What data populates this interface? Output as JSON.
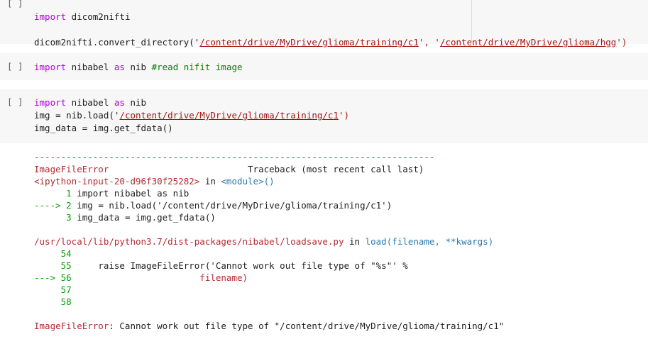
{
  "cells": [
    {
      "run_label": "[ ]",
      "lines": [
        {
          "kw": "import",
          "rest": " dicom2nifti"
        },
        {
          "blank": true
        },
        {
          "pre": "dicom2nifti.convert_directory('",
          "s1": "/content/drive/MyDrive/glioma/training/c1",
          "mid": "', '",
          "s2": "/content/drive/MyDrive/glioma/hgg",
          "post": "')"
        }
      ]
    },
    {
      "run_label": "[ ]",
      "kw": "import",
      "mod": " nibabel ",
      "kw2": "as",
      "alias": " nib ",
      "comment": "#read nifit image"
    },
    {
      "run_label": "[ ]",
      "line1_kw": "import",
      "line1_mod": " nibabel ",
      "line1_kw2": "as",
      "line1_alias": " nib",
      "line2_pre": "img = nib.load('",
      "line2_str": "/content/drive/MyDrive/glioma/training/c1",
      "line2_post": "')",
      "line3": "img_data = img.get_fdata()"
    }
  ],
  "output": {
    "dashes": "---------------------------------------------------------------------------",
    "err_name": "ImageFileError",
    "traceback_label": "                          Traceback (most recent call last)",
    "input_ref": "<ipython-input-20-d96f30f25282>",
    "in_word": " in ",
    "module_ref": "<module>()",
    "l1_num": "      1 ",
    "l1_code": "import nibabel as nib",
    "l2_arrow": "----> 2 ",
    "l2_code": "img = nib.load('/content/drive/MyDrive/glioma/training/c1')",
    "l3_num": "      3 ",
    "l3_code": "img_data = img.get_fdata()",
    "file_path": "/usr/local/lib/python3.7/dist-packages/nibabel/loadsave.py",
    "func_ref": "load(filename, **kwargs)",
    "n54": "     54",
    "n55": "     55",
    "l55_code": "     raise ImageFileError('Cannot work out file type of \"%s\"' %",
    "a56": "---> 56",
    "l56_code": "                        filename)",
    "n57": "     57",
    "n58": "     58",
    "final_name": "ImageFileError",
    "final_msg": ": Cannot work out file type of \"/content/drive/MyDrive/glioma/training/c1\""
  }
}
